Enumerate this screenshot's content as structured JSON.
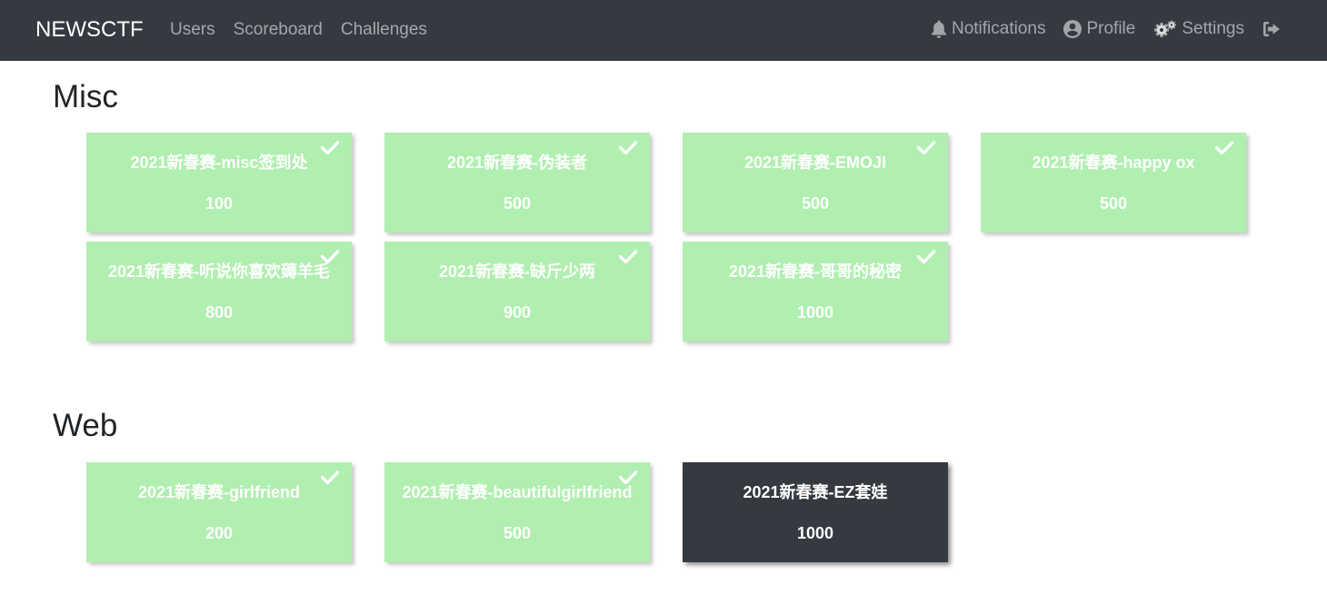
{
  "navbar": {
    "brand": "NEWSCTF",
    "left_links": [
      "Users",
      "Scoreboard",
      "Challenges"
    ],
    "right_links": [
      {
        "label": "Notifications",
        "icon": "bell-icon"
      },
      {
        "label": "Profile",
        "icon": "user-circle-icon"
      },
      {
        "label": "Settings",
        "icon": "gears-icon"
      },
      {
        "label": "",
        "icon": "logout-icon"
      }
    ]
  },
  "colors": {
    "navbar_bg": "#343a40",
    "solved_card": "#b0efb0",
    "unsolved_card": "#343a40"
  },
  "categories": [
    {
      "name": "Misc",
      "challenges": [
        {
          "name": "2021新春赛-misc签到处",
          "value": "100",
          "solved": true
        },
        {
          "name": "2021新春赛-伪装者",
          "value": "500",
          "solved": true
        },
        {
          "name": "2021新春赛-EMOJI",
          "value": "500",
          "solved": true
        },
        {
          "name": "2021新春赛-happy ox",
          "value": "500",
          "solved": true
        },
        {
          "name": "2021新春赛-听说你喜欢薅羊毛",
          "value": "800",
          "solved": true
        },
        {
          "name": "2021新春赛-缺斤少两",
          "value": "900",
          "solved": true
        },
        {
          "name": "2021新春赛-哥哥的秘密",
          "value": "1000",
          "solved": true
        }
      ]
    },
    {
      "name": "Web",
      "challenges": [
        {
          "name": "2021新春赛-girlfriend",
          "value": "200",
          "solved": true
        },
        {
          "name": "2021新春赛-beautifulgirlfriend",
          "value": "500",
          "solved": true
        },
        {
          "name": "2021新春赛-EZ套娃",
          "value": "1000",
          "solved": false
        }
      ]
    }
  ]
}
